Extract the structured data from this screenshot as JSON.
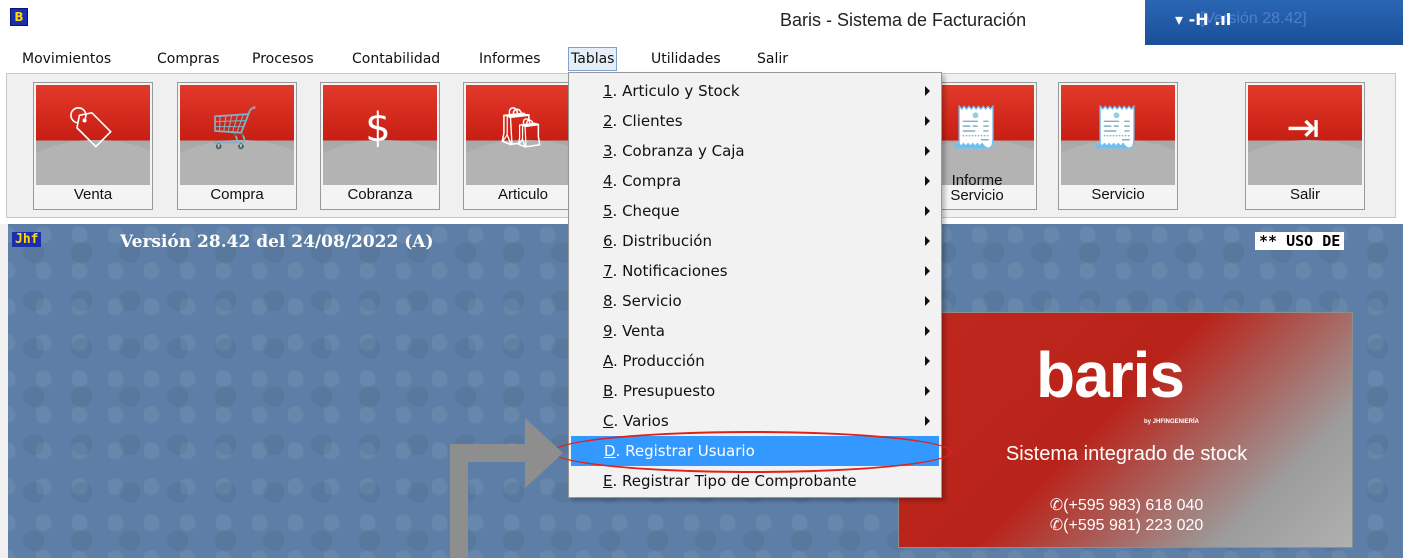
{
  "window": {
    "app_icon": "B",
    "title": "Baris - Sistema de Facturación",
    "title_right_text": "[Versión 28.42]",
    "title_right_glyphs": "▾ -H .ıl"
  },
  "menubar": {
    "items": [
      "Movimientos",
      "Compras",
      "Procesos",
      "Contabilidad",
      "Informes",
      "Tablas",
      "Utilidades",
      "Salir"
    ],
    "active": "Tablas"
  },
  "toolbar": {
    "buttons": [
      {
        "label": "Venta",
        "icon": "tag-icon"
      },
      {
        "label": "Compra",
        "icon": "cart-icon"
      },
      {
        "label": "Cobranza",
        "icon": "money-hand-icon"
      },
      {
        "label": "Articulo",
        "icon": "bag-icon"
      },
      {
        "label": "Informe\nServicio",
        "icon": "invoice-icon"
      },
      {
        "label": "Servicio",
        "icon": "invoice-hand-icon"
      },
      {
        "label": "Salir",
        "icon": "exit-icon"
      }
    ]
  },
  "status": {
    "jhf": "Jhf",
    "version": "Versión 28.42 del 24/08/2022  (A)",
    "uso": "** USO DE"
  },
  "dropdown": {
    "items": [
      {
        "key": "1",
        "text": ". Articulo y Stock",
        "submenu": true
      },
      {
        "key": "2",
        "text": ". Clientes",
        "submenu": true
      },
      {
        "key": "3",
        "text": ". Cobranza y Caja",
        "submenu": true
      },
      {
        "key": "4",
        "text": ". Compra",
        "submenu": true
      },
      {
        "key": "5",
        "text": ". Cheque",
        "submenu": true
      },
      {
        "key": "6",
        "text": ". Distribución",
        "submenu": true
      },
      {
        "key": "7",
        "text": ". Notificaciones",
        "submenu": true
      },
      {
        "key": "8",
        "text": ". Servicio",
        "submenu": true
      },
      {
        "key": "9",
        "text": ". Venta",
        "submenu": true
      },
      {
        "key": "A",
        "text": ". Producción",
        "submenu": true
      },
      {
        "key": "B",
        "text": ". Presupuesto",
        "submenu": true
      },
      {
        "key": "C",
        "text": ". Varios",
        "submenu": true
      },
      {
        "key": "D",
        "text": ". Registrar Usuario",
        "submenu": false,
        "selected": true
      },
      {
        "key": "E",
        "text": ". Registrar Tipo de Comprobante",
        "submenu": false
      }
    ]
  },
  "banner": {
    "logo": "baris",
    "by": "by JHFINGENIERÍA",
    "subtitle": "Sistema integrado de stock",
    "phone1": "✆(+595 983) 618 040",
    "phone2": "✆(+595 981) 223 020"
  },
  "colors": {
    "menu_selected": "#3399ff",
    "annotation_ellipse": "#e0201a",
    "desktop_bg": "#5d7fa7"
  }
}
